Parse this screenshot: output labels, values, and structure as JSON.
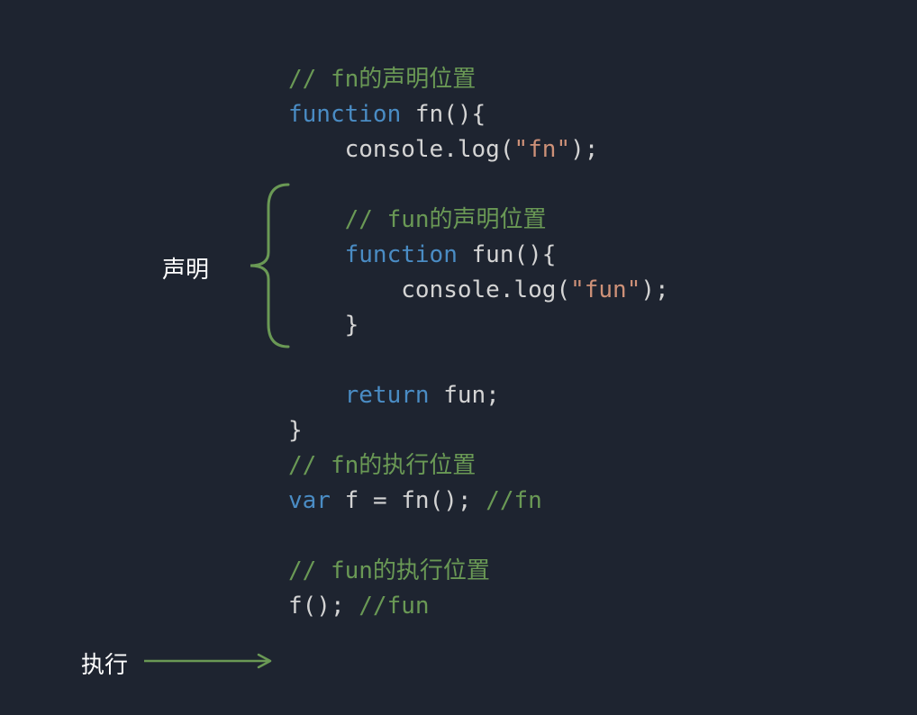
{
  "annotations": {
    "declaration": "声明",
    "execution": "执行"
  },
  "code": {
    "line1_comment": "// fn的声明位置",
    "line2_keyword": "function",
    "line2_name": " fn",
    "line2_paren": "(){",
    "line3_indent": "    ",
    "line3_obj": "console",
    "line3_dot": ".",
    "line3_method": "log",
    "line3_open": "(",
    "line3_str": "\"fn\"",
    "line3_close": ");",
    "line5_indent": "    ",
    "line5_comment": "// fun的声明位置",
    "line6_indent": "    ",
    "line6_keyword": "function",
    "line6_name": " fun",
    "line6_paren": "(){",
    "line7_indent": "        ",
    "line7_obj": "console",
    "line7_dot": ".",
    "line7_method": "log",
    "line7_open": "(",
    "line7_str": "\"fun\"",
    "line7_close": ");",
    "line8_indent": "    ",
    "line8_brace": "}",
    "line10_indent": "    ",
    "line10_keyword": "return",
    "line10_name": " fun",
    "line10_semi": ";",
    "line11_brace": "}",
    "line12_comment": "// fn的执行位置",
    "line13_keyword": "var",
    "line13_name": " f ",
    "line13_eq": "= ",
    "line13_call": "fn",
    "line13_paren": "(); ",
    "line13_comment": "//fn",
    "line15_comment": "// fun的执行位置",
    "line16_call": "f",
    "line16_paren": "(); ",
    "line16_comment": "//fun"
  }
}
